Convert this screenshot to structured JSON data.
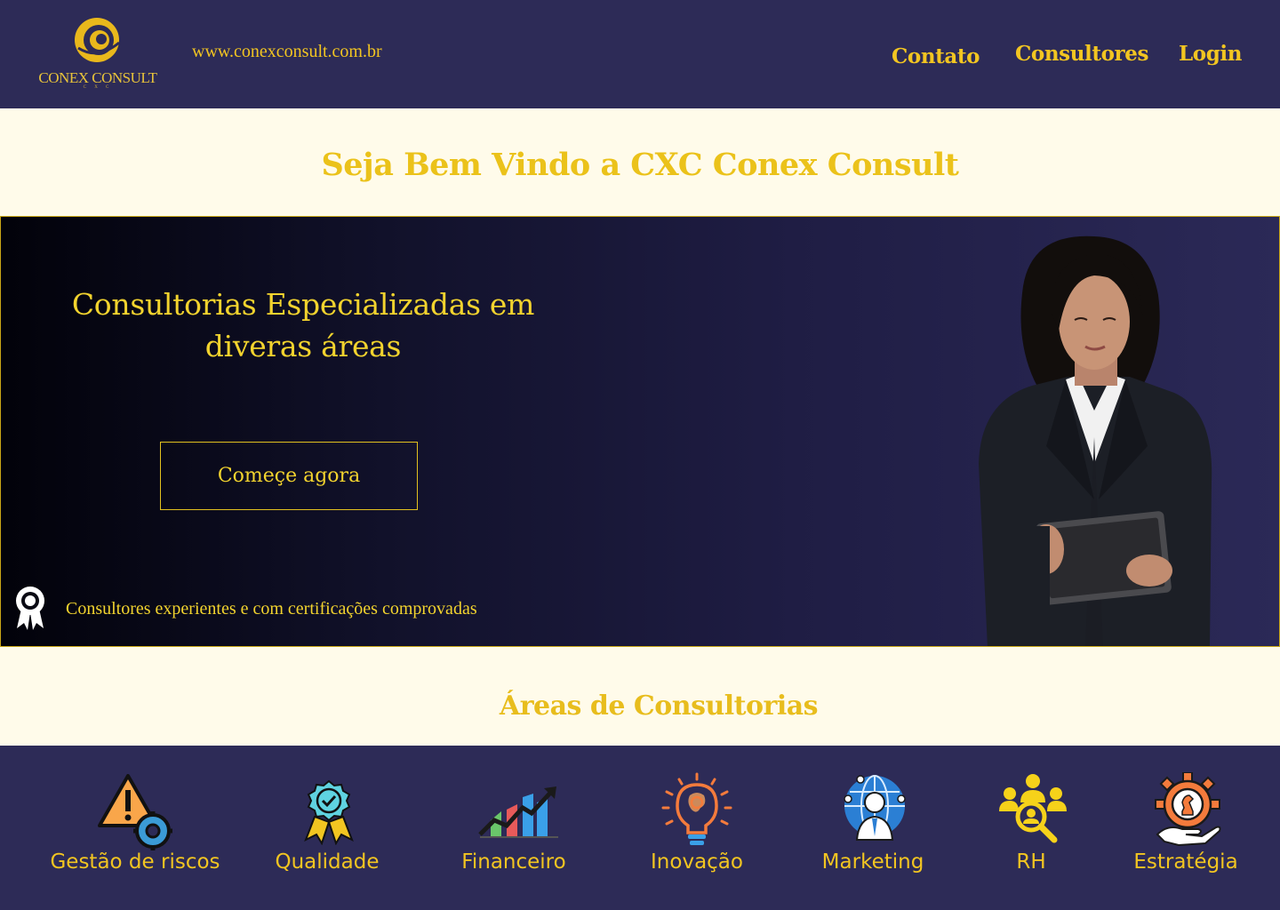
{
  "header": {
    "logo_text": "CONEX CONSULT",
    "logo_sub": "C X C",
    "site_url": "www.conexconsult.com.br",
    "nav": {
      "contato": "Contato",
      "consultores": "Consultores",
      "login": "Login"
    }
  },
  "welcome": {
    "title": "Seja Bem Vindo a CXC Conex Consult"
  },
  "hero": {
    "title_line1": "Consultorias Especializadas em",
    "title_line2": "diveras áreas",
    "cta_label": "Começe agora",
    "badge_text": "Consultores experientes e com certificações comprovadas"
  },
  "areas": {
    "title": "Áreas de Consultorias",
    "items": [
      {
        "label": "Gestão de riscos",
        "icon": "warning-gear-icon"
      },
      {
        "label": "Qualidade",
        "icon": "quality-badge-icon"
      },
      {
        "label": "Financeiro",
        "icon": "finance-chart-icon"
      },
      {
        "label": "Inovação",
        "icon": "innovation-bulb-icon"
      },
      {
        "label": "Marketing",
        "icon": "marketing-globe-icon"
      },
      {
        "label": "RH",
        "icon": "hr-people-icon"
      },
      {
        "label": "Estratégia",
        "icon": "strategy-gear-icon"
      }
    ]
  },
  "colors": {
    "navy": "#2d2b57",
    "gold": "#f2c521",
    "cream": "#fffbea"
  }
}
